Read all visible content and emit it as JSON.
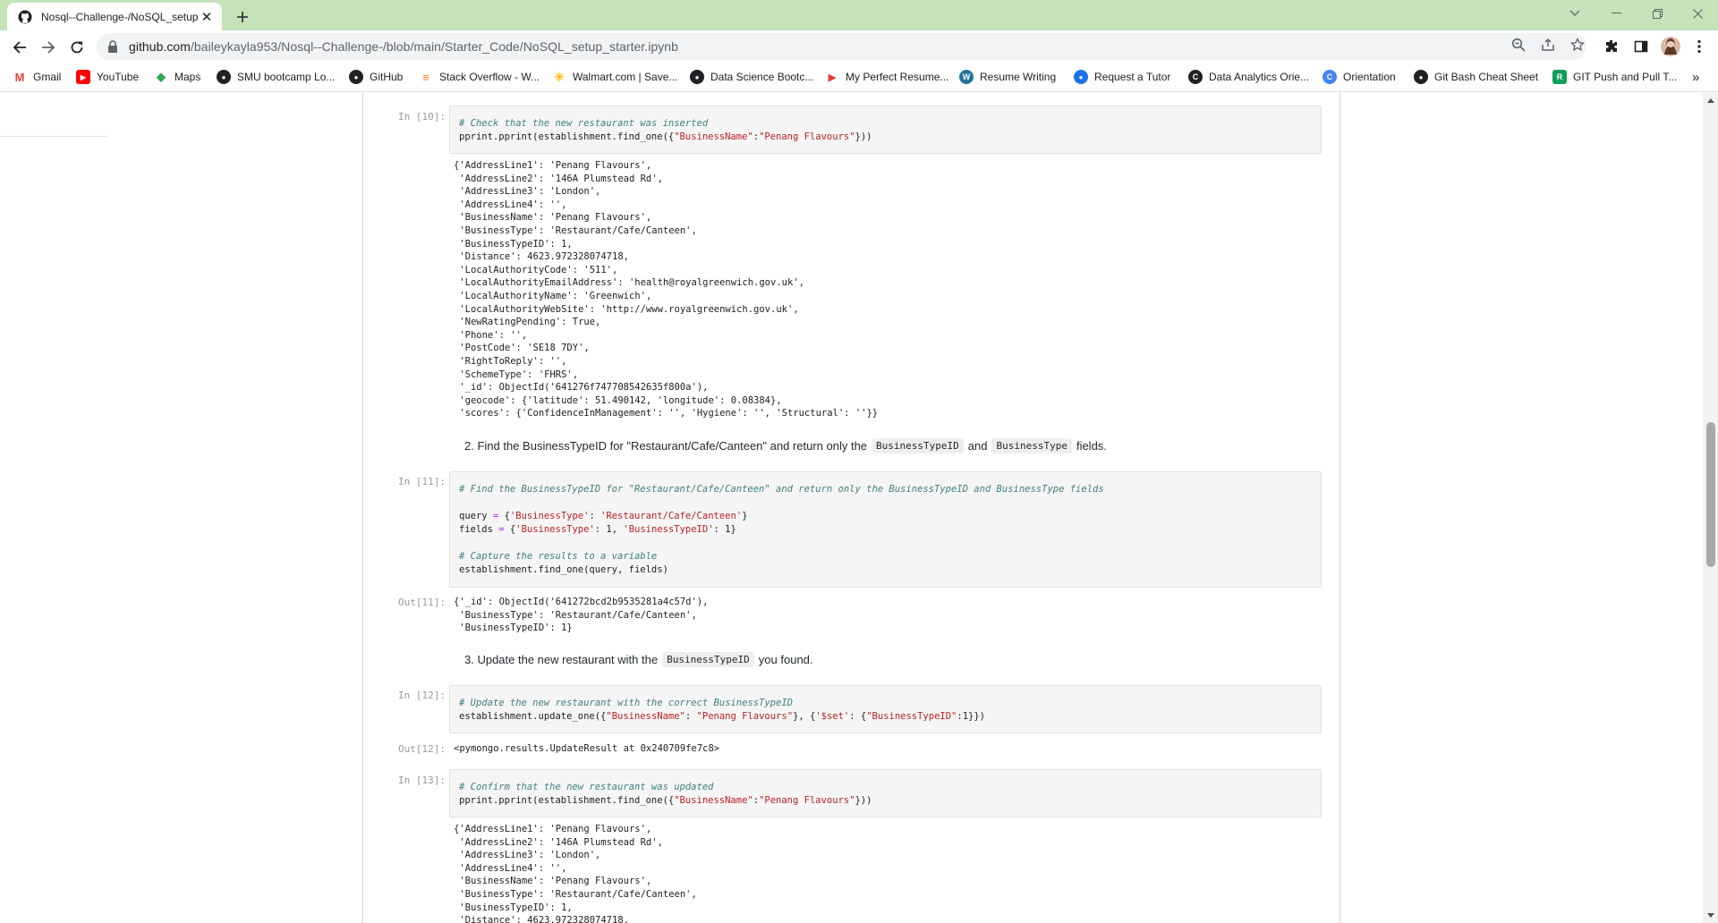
{
  "browser": {
    "tab_title": "Nosql--Challenge-/NoSQL_setup",
    "url_host": "github.com",
    "url_path": "/baileykayla953/Nosql--Challenge-/blob/main/Starter_Code/NoSQL_setup_starter.ipynb",
    "icons": [
      "github-icon",
      "close-icon",
      "plus-icon",
      "back-icon",
      "forward-icon",
      "reload-icon",
      "lock-icon",
      "zoom-icon",
      "share-icon",
      "star-icon",
      "extensions-icon",
      "sidepanel-icon",
      "avatar",
      "menu-icon"
    ]
  },
  "bookmarks": [
    {
      "label": "Gmail",
      "icon": "gmail-icon",
      "color": "#ea4335",
      "glyph": "M"
    },
    {
      "label": "YouTube",
      "icon": "youtube-icon",
      "color": "#ff0000",
      "glyph": "▶"
    },
    {
      "label": "Maps",
      "icon": "maps-icon",
      "color": "#34a853",
      "glyph": "◆"
    },
    {
      "label": "SMU bootcamp Lo...",
      "icon": "globe-icon",
      "color": "#202124",
      "glyph": "●"
    },
    {
      "label": "GitHub",
      "icon": "github-icon",
      "color": "#202124",
      "glyph": "●"
    },
    {
      "label": "Stack Overflow - W...",
      "icon": "stackoverflow-icon",
      "color": "#f48024",
      "glyph": "≡"
    },
    {
      "label": "Walmart.com | Save...",
      "icon": "walmart-icon",
      "color": "#ffc220",
      "glyph": "✳"
    },
    {
      "label": "Data Science Bootc...",
      "icon": "globe-icon",
      "color": "#202124",
      "glyph": "●"
    },
    {
      "label": "My Perfect Resume...",
      "icon": "resume-icon",
      "color": "#e53935",
      "glyph": "▶"
    },
    {
      "label": "Resume Writing",
      "icon": "wordpress-icon",
      "color": "#21759b",
      "glyph": "W"
    },
    {
      "label": "Request a Tutor",
      "icon": "tutor-icon",
      "color": "#1a73e8",
      "glyph": "●"
    },
    {
      "label": "Data Analytics Orie...",
      "icon": "globe-icon",
      "color": "#202124",
      "glyph": "C"
    },
    {
      "label": "Orientation",
      "icon": "orientation-icon",
      "color": "#4285f4",
      "glyph": "C"
    },
    {
      "label": "Git Bash Cheat Sheet",
      "icon": "github-icon",
      "color": "#202124",
      "glyph": "●"
    },
    {
      "label": "GIT Push and Pull T...",
      "icon": "sheet-icon",
      "color": "#0f9d58",
      "glyph": "R"
    }
  ],
  "bookmarks_more": "»",
  "cells": {
    "in10_prompt": "In [10]:",
    "in10_code": [
      {
        "t": "cm",
        "v": "# Check that the new restaurant was inserted"
      },
      {
        "t": "code",
        "v": "pprint.pprint(establishment.find_one({\"BusinessName\":\"Penang Flavours\"}))"
      }
    ],
    "out10": "{'AddressLine1': 'Penang Flavours',\n 'AddressLine2': '146A Plumstead Rd',\n 'AddressLine3': 'London',\n 'AddressLine4': '',\n 'BusinessName': 'Penang Flavours',\n 'BusinessType': 'Restaurant/Cafe/Canteen',\n 'BusinessTypeID': 1,\n 'Distance': 4623.972328074718,\n 'LocalAuthorityCode': '511',\n 'LocalAuthorityEmailAddress': 'health@royalgreenwich.gov.uk',\n 'LocalAuthorityName': 'Greenwich',\n 'LocalAuthorityWebSite': 'http://www.royalgreenwich.gov.uk',\n 'NewRatingPending': True,\n 'Phone': '',\n 'PostCode': 'SE18 7DY',\n 'RightToReply': '',\n 'SchemeType': 'FHRS',\n '_id': ObjectId('641276f747708542635f800a'),\n 'geocode': {'latitude': 51.490142, 'longitude': 0.08384},\n 'scores': {'ConfidenceInManagement': '', 'Hygiene': '', 'Structural': ''}}",
    "md2_a": "2. Find the BusinessTypeID for \"Restaurant/Cafe/Canteen\" and return only the",
    "md2_code1": "BusinessTypeID",
    "md2_b": "and",
    "md2_code2": "BusinessType",
    "md2_c": "fields.",
    "in11_prompt": "In [11]:",
    "in11_code": [
      {
        "t": "cm",
        "v": "# Find the BusinessTypeID for \"Restaurant/Cafe/Canteen\" and return only the BusinessTypeID and BusinessType fields"
      },
      {
        "t": "code",
        "v": ""
      },
      {
        "t": "code",
        "v": "query = {'BusinessType': 'Restaurant/Cafe/Canteen'}"
      },
      {
        "t": "code",
        "v": "fields = {'BusinessType': 1, 'BusinessTypeID': 1}"
      },
      {
        "t": "code",
        "v": ""
      },
      {
        "t": "cm",
        "v": "# Capture the results to a variable"
      },
      {
        "t": "code",
        "v": "establishment.find_one(query, fields)"
      }
    ],
    "out11_prompt": "Out[11]:",
    "out11": "{'_id': ObjectId('641272bcd2b9535281a4c57d'),\n 'BusinessType': 'Restaurant/Cafe/Canteen',\n 'BusinessTypeID': 1}",
    "md3_a": "3. Update the new restaurant with the",
    "md3_code": "BusinessTypeID",
    "md3_b": "you found.",
    "in12_prompt": "In [12]:",
    "in12_code": [
      {
        "t": "cm",
        "v": "# Update the new restaurant with the correct BusinessTypeID"
      },
      {
        "t": "code",
        "v": "establishment.update_one({\"BusinessName\": \"Penang Flavours\"}, {'$set': {\"BusinessTypeID\":1}})"
      }
    ],
    "out12_prompt": "Out[12]:",
    "out12": "<pymongo.results.UpdateResult at 0x240709fe7c8>",
    "in13_prompt": "In [13]:",
    "in13_code": [
      {
        "t": "cm",
        "v": "# Confirm that the new restaurant was updated"
      },
      {
        "t": "code",
        "v": "pprint.pprint(establishment.find_one({\"BusinessName\":\"Penang Flavours\"}))"
      }
    ],
    "out13": "{'AddressLine1': 'Penang Flavours',\n 'AddressLine2': '146A Plumstead Rd',\n 'AddressLine3': 'London',\n 'AddressLine4': '',\n 'BusinessName': 'Penang Flavours',\n 'BusinessType': 'Restaurant/Cafe/Canteen',\n 'BusinessTypeID': 1,\n 'Distance': 4623.972328074718,"
  }
}
